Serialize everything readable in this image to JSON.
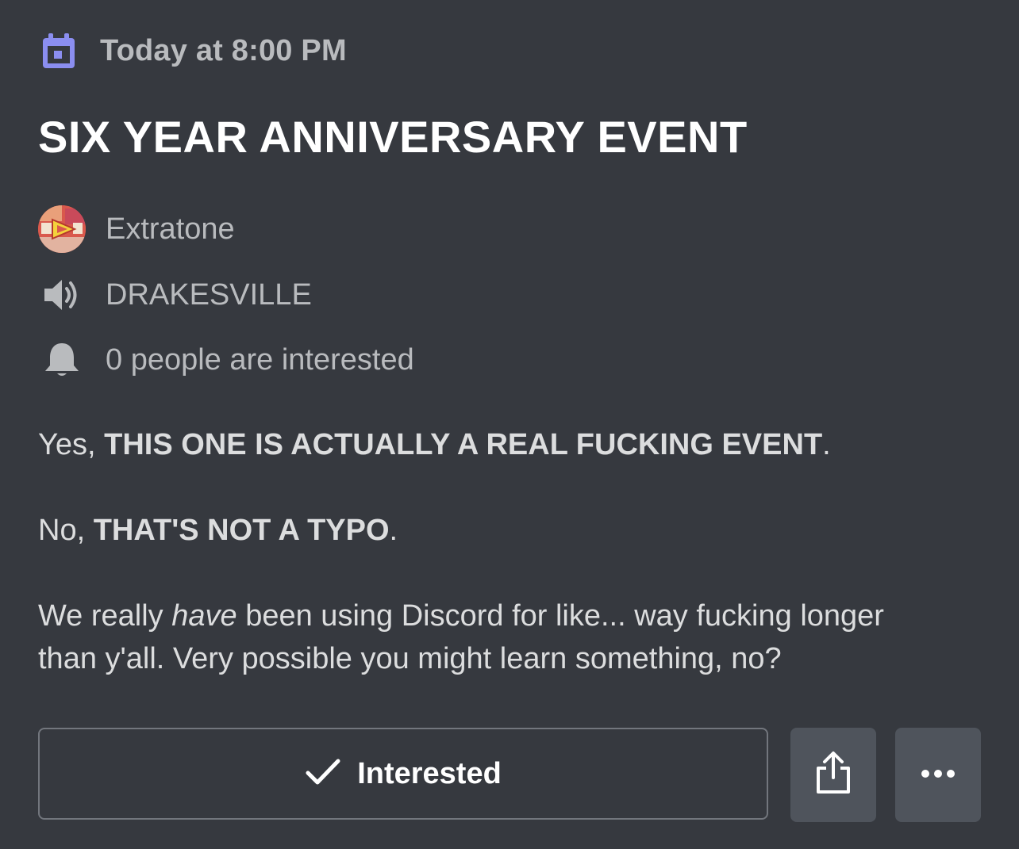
{
  "event": {
    "time": "Today at 8:00 PM",
    "title": "SIX YEAR ANNIVERSARY EVENT",
    "server_name": "Extratone",
    "channel_name": "DRAKESVILLE",
    "interested_text": "0 people are interested"
  },
  "description": {
    "p1_prefix": "Yes, ",
    "p1_bold": "THIS ONE IS ACTUALLY A REAL FUCKING EVENT",
    "p1_suffix": ".",
    "p2_prefix": "No, ",
    "p2_bold": "THAT'S NOT A TYPO",
    "p2_suffix": ".",
    "p3_line1_prefix": "We really ",
    "p3_line1_italic": "have",
    "p3_line1_suffix": " been using Discord for like... way fucking longer",
    "p3_line2": "than y'all. Very possible you might learn something, no?"
  },
  "actions": {
    "interested_label": "Interested"
  },
  "icons": {
    "calendar": "calendar-icon",
    "speaker": "speaker-icon",
    "bell": "bell-icon",
    "check": "check-icon",
    "share": "share-icon",
    "more": "more-icon"
  },
  "colors": {
    "background": "#36393f",
    "accent": "#7289da",
    "button": "#4f545c"
  }
}
